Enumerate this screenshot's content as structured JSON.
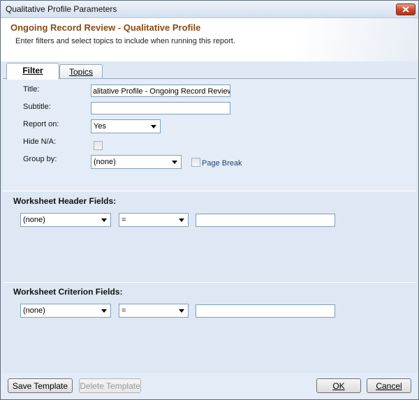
{
  "window": {
    "title": "Qualitative Profile Parameters"
  },
  "header": {
    "title": "Ongoing Record Review - Qualitative Profile",
    "subtitle": "Enter filters and select topics to include when running this report."
  },
  "tabs": [
    {
      "label": "Filter",
      "active": true
    },
    {
      "label": "Topics",
      "active": false
    }
  ],
  "filter": {
    "title_label": "Title:",
    "title_value": "alitative Profile - Ongoing Record Review",
    "subtitle_label": "Subtitle:",
    "subtitle_value": "",
    "report_on_label": "Report on:",
    "report_on_value": "Yes",
    "hide_na_label": "Hide N/A:",
    "group_by_label": "Group by:",
    "group_by_value": "(none)",
    "page_break_label": "Page Break"
  },
  "worksheet_header": {
    "label": "Worksheet Header Fields:",
    "field_value": "(none)",
    "operator_value": "=",
    "value": ""
  },
  "worksheet_criterion": {
    "label": "Worksheet Criterion Fields:",
    "field_value": "(none)",
    "operator_value": "=",
    "value": ""
  },
  "footer": {
    "save_template": "Save Template",
    "delete_template": "Delete Template",
    "ok": "OK",
    "cancel": "Cancel"
  }
}
